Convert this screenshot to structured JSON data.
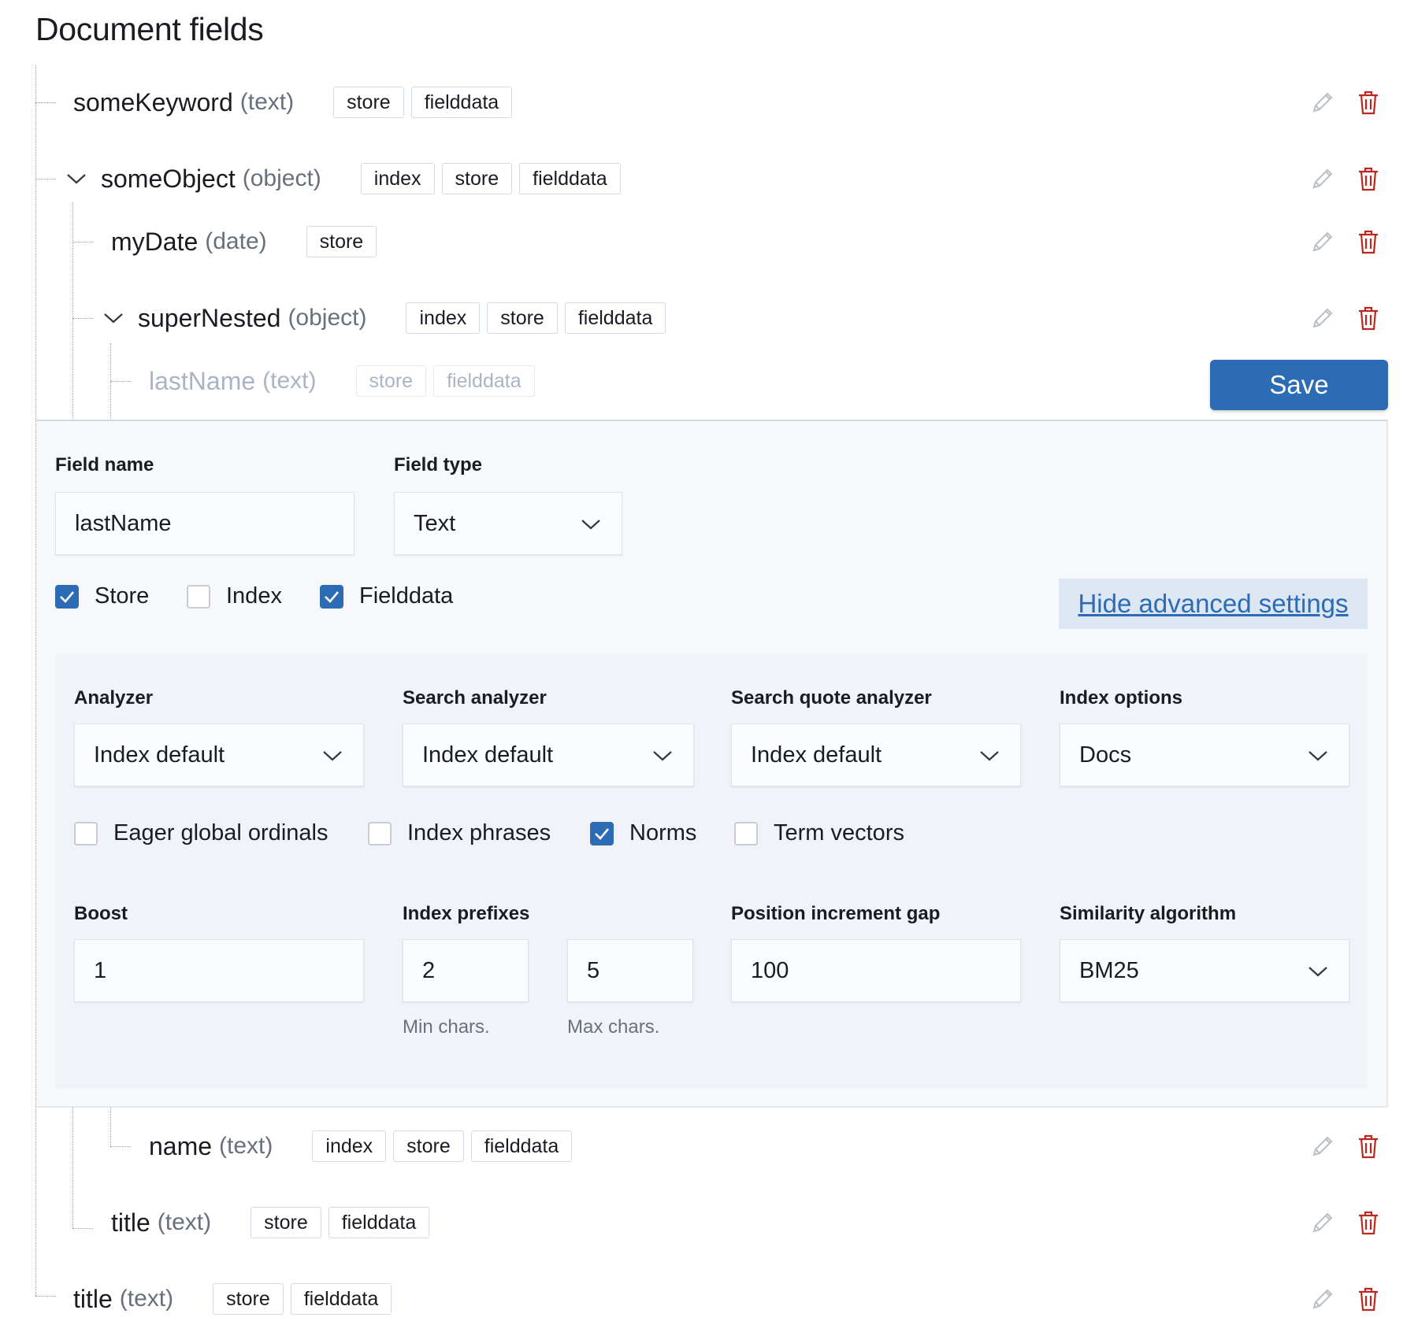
{
  "title": "Document fields",
  "tree": {
    "some_keyword": {
      "name": "someKeyword",
      "type": "(text)",
      "badges": [
        "store",
        "fielddata"
      ]
    },
    "some_object": {
      "name": "someObject",
      "type": "(object)",
      "badges": [
        "index",
        "store",
        "fielddata"
      ]
    },
    "my_date": {
      "name": "myDate",
      "type": "(date)",
      "badges": [
        "store"
      ]
    },
    "super_nested": {
      "name": "superNested",
      "type": "(object)",
      "badges": [
        "index",
        "store",
        "fielddata"
      ]
    },
    "last_name": {
      "name": "lastName",
      "type": "(text)",
      "badges": [
        "store",
        "fielddata"
      ]
    },
    "name_field": {
      "name": "name",
      "type": "(text)",
      "badges": [
        "index",
        "store",
        "fielddata"
      ]
    },
    "title_nested": {
      "name": "title",
      "type": "(text)",
      "badges": [
        "store",
        "fielddata"
      ]
    },
    "title_root": {
      "name": "title",
      "type": "(text)",
      "badges": [
        "store",
        "fielddata"
      ]
    }
  },
  "save_label": "Save",
  "editor": {
    "field_name_label": "Field name",
    "field_name_value": "lastName",
    "field_type_label": "Field type",
    "field_type_value": "Text",
    "checkboxes": [
      {
        "label": "Store",
        "checked": true
      },
      {
        "label": "Index",
        "checked": false
      },
      {
        "label": "Fielddata",
        "checked": true
      }
    ],
    "advanced_link": "Hide advanced settings",
    "advanced": {
      "analyzer_label": "Analyzer",
      "analyzer_value": "Index default",
      "search_analyzer_label": "Search analyzer",
      "search_analyzer_value": "Index default",
      "search_quote_analyzer_label": "Search quote analyzer",
      "search_quote_analyzer_value": "Index default",
      "index_options_label": "Index options",
      "index_options_value": "Docs",
      "checkboxes": [
        {
          "label": "Eager global ordinals",
          "checked": false
        },
        {
          "label": "Index phrases",
          "checked": false
        },
        {
          "label": "Norms",
          "checked": true
        },
        {
          "label": "Term vectors",
          "checked": false
        }
      ],
      "boost_label": "Boost",
      "boost_value": "1",
      "index_prefixes_label": "Index prefixes",
      "min_chars_value": "2",
      "max_chars_value": "5",
      "min_chars_hint": "Min chars.",
      "max_chars_hint": "Max chars.",
      "position_increment_gap_label": "Position increment gap",
      "position_increment_gap_value": "100",
      "similarity_label": "Similarity algorithm",
      "similarity_value": "BM25"
    }
  },
  "icons": {
    "edit": "pencil-icon",
    "delete": "trash-icon",
    "expand": "chevron-down-icon",
    "select": "chevron-down-icon",
    "check": "checkmark-icon"
  },
  "colors": {
    "primary": "#2b6cb5",
    "delete": "#bd271e",
    "muted_text": "#69707d"
  }
}
